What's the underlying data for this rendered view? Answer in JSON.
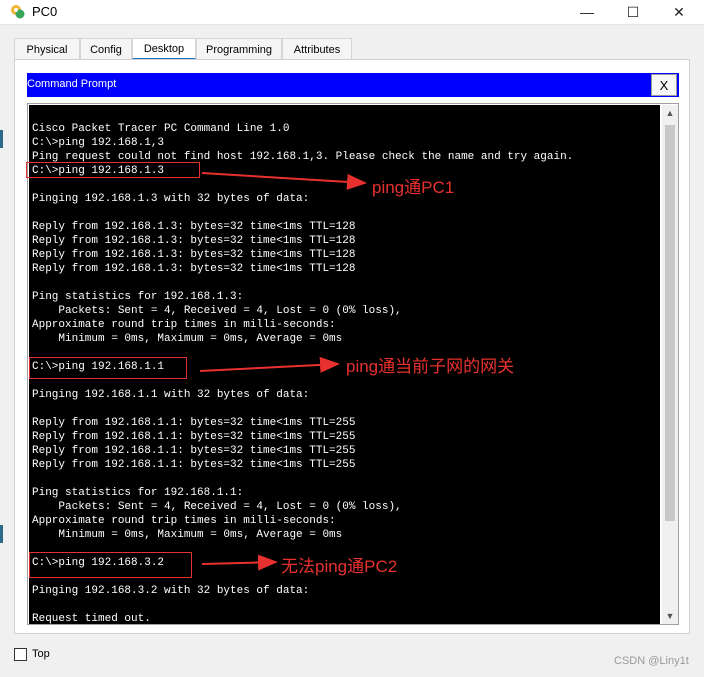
{
  "window": {
    "title": "PC0",
    "min_glyph": "—",
    "max_glyph": "☐",
    "close_glyph": "✕",
    "app_icon": "packet-tracer-pc-icon"
  },
  "tabs": [
    {
      "label": "Physical"
    },
    {
      "label": "Config"
    },
    {
      "label": "Desktop",
      "active": true
    },
    {
      "label": "Programming"
    },
    {
      "label": "Attributes"
    }
  ],
  "command_prompt": {
    "title": "Command Prompt",
    "close_label": "X",
    "lines": [
      "Cisco Packet Tracer PC Command Line 1.0",
      "C:\\>ping 192.168.1,3",
      "Ping request could not find host 192.168.1,3. Please check the name and try again.",
      "C:\\>ping 192.168.1.3",
      "",
      "Pinging 192.168.1.3 with 32 bytes of data:",
      "",
      "Reply from 192.168.1.3: bytes=32 time<1ms TTL=128",
      "Reply from 192.168.1.3: bytes=32 time<1ms TTL=128",
      "Reply from 192.168.1.3: bytes=32 time<1ms TTL=128",
      "Reply from 192.168.1.3: bytes=32 time<1ms TTL=128",
      "",
      "Ping statistics for 192.168.1.3:",
      "    Packets: Sent = 4, Received = 4, Lost = 0 (0% loss),",
      "Approximate round trip times in milli-seconds:",
      "    Minimum = 0ms, Maximum = 0ms, Average = 0ms",
      "",
      "C:\\>ping 192.168.1.1",
      "",
      "Pinging 192.168.1.1 with 32 bytes of data:",
      "",
      "Reply from 192.168.1.1: bytes=32 time<1ms TTL=255",
      "Reply from 192.168.1.1: bytes=32 time<1ms TTL=255",
      "Reply from 192.168.1.1: bytes=32 time<1ms TTL=255",
      "Reply from 192.168.1.1: bytes=32 time<1ms TTL=255",
      "",
      "Ping statistics for 192.168.1.1:",
      "    Packets: Sent = 4, Received = 4, Lost = 0 (0% loss),",
      "Approximate round trip times in milli-seconds:",
      "    Minimum = 0ms, Maximum = 0ms, Average = 0ms",
      "",
      "C:\\>ping 192.168.3.2",
      "",
      "Pinging 192.168.3.2 with 32 bytes of data:",
      "",
      "Request timed out."
    ]
  },
  "annotations": [
    {
      "text": "ping通PC1"
    },
    {
      "text": "ping通当前子网的网关"
    },
    {
      "text": "无法ping通PC2"
    }
  ],
  "footer": {
    "top_label": "Top",
    "top_checked": false,
    "watermark": "CSDN @Liny1t"
  },
  "colors": {
    "command_bar": "#0000ff",
    "terminal_bg": "#000000",
    "annotation": "#e8312f",
    "active_tab_underline": "#1a73c8"
  }
}
